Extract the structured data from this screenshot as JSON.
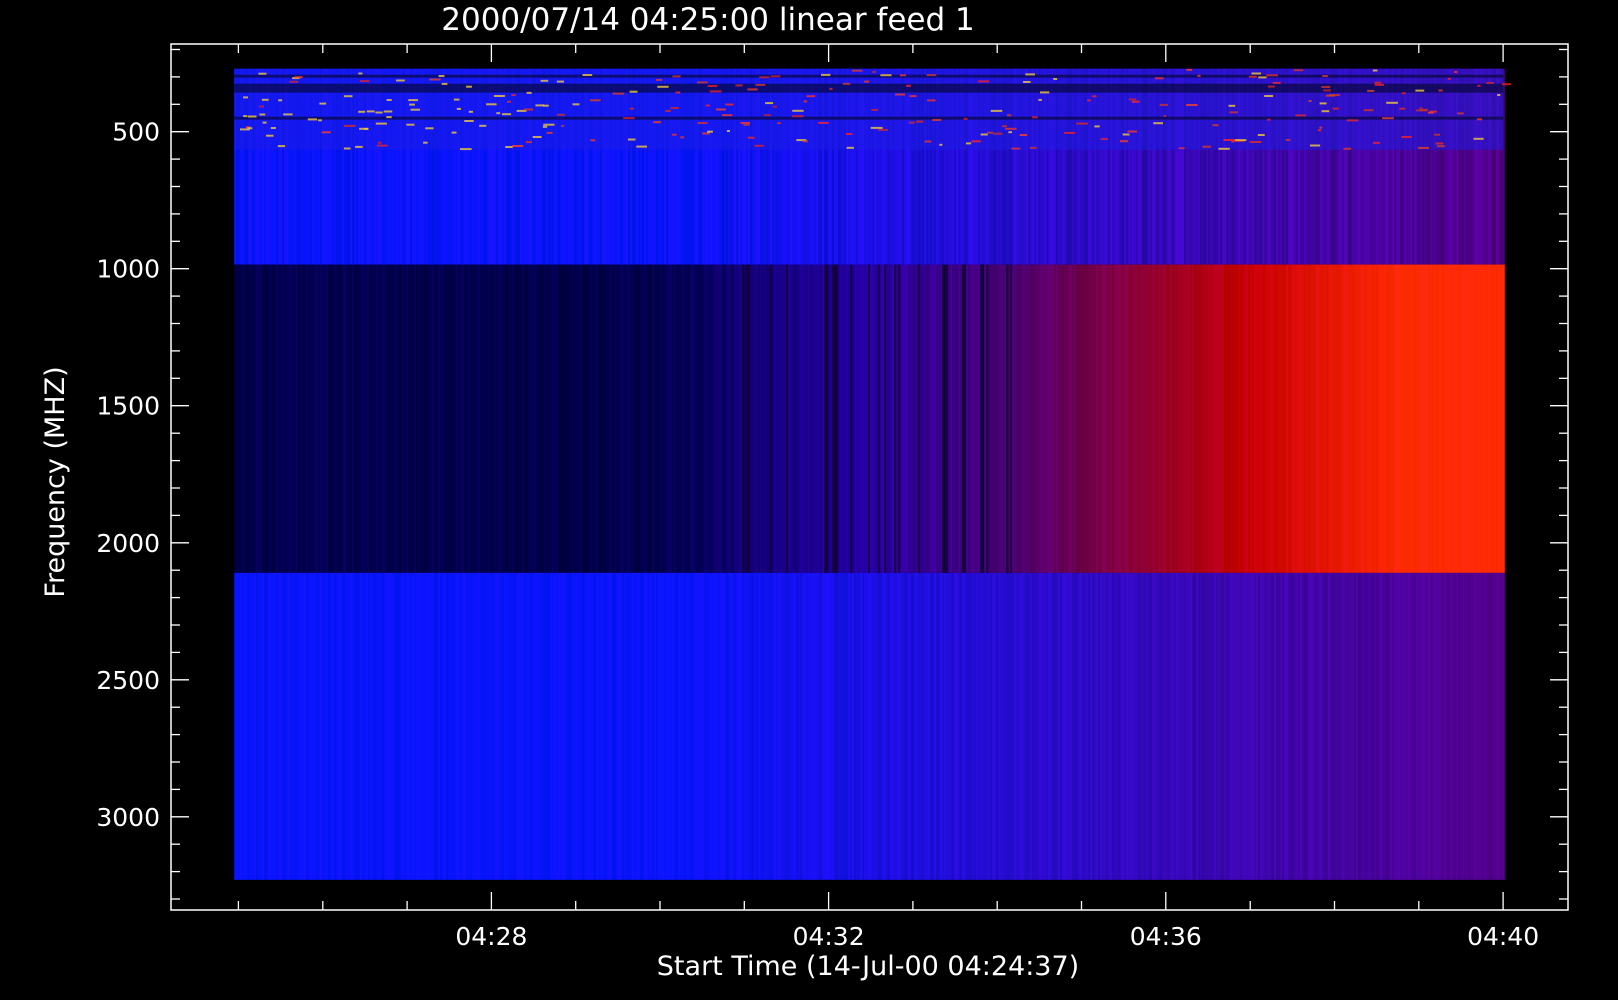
{
  "chart_data": {
    "type": "heatmap",
    "title": "2000/07/14 04:25:00 linear feed 1",
    "xlabel": "Start Time (14-Jul-00 04:24:37)",
    "ylabel": "Frequency (MHZ)",
    "x_ticks": [
      {
        "minute": 28,
        "label": "04:28"
      },
      {
        "minute": 32,
        "label": "04:32"
      },
      {
        "minute": 36,
        "label": "04:36"
      },
      {
        "minute": 40,
        "label": "04:40"
      }
    ],
    "y_ticks": [
      {
        "value": 500,
        "label": "500"
      },
      {
        "value": 1000,
        "label": "1000"
      },
      {
        "value": 1500,
        "label": "1500"
      },
      {
        "value": 2000,
        "label": "2000"
      },
      {
        "value": 2500,
        "label": "2500"
      },
      {
        "value": 3000,
        "label": "3000"
      }
    ],
    "xlim_minutes": [
      24.2,
      40.77
    ],
    "ylim": [
      180,
      3340
    ],
    "data_time_range_minutes": [
      24.95,
      40.0
    ],
    "y_reversed": true,
    "colors": {
      "blue": "#0a14ff",
      "navy": "#00004e",
      "purple": "#54008c",
      "red": "#ff2a00",
      "axes": "#ffffff",
      "background": "#000000"
    },
    "bands": [
      {
        "name": "band-low",
        "freq_range": [
          270,
          985
        ],
        "profile": "blue-to-purple",
        "noise": "high"
      },
      {
        "name": "band-mid",
        "freq_range": [
          985,
          2110
        ],
        "profile": "navy-to-red",
        "noise": "medium"
      },
      {
        "name": "band-high",
        "freq_range": [
          2110,
          3230
        ],
        "profile": "blue-to-purple",
        "noise": "medium"
      }
    ]
  }
}
